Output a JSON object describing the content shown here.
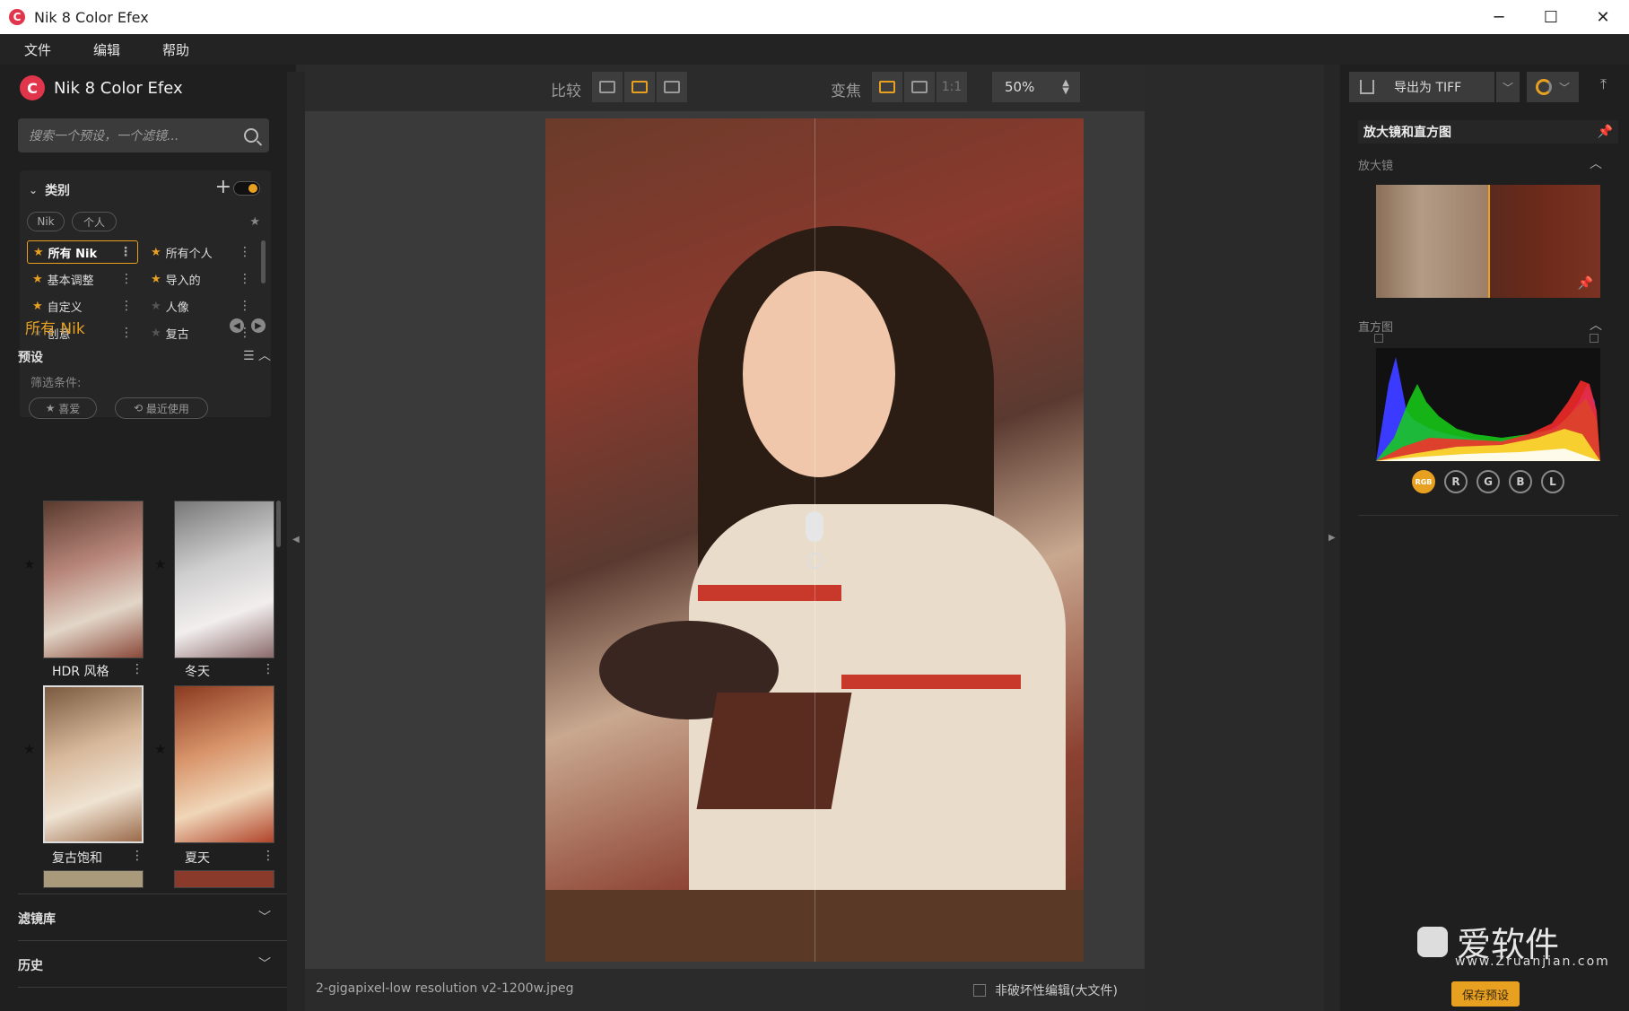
{
  "window": {
    "title": "Nik 8 Color Efex",
    "minimize": "─",
    "maximize": "☐",
    "close": "✕"
  },
  "menu": [
    "文件",
    "编辑",
    "帮助"
  ],
  "brand": {
    "name": "Nik 8 Color Efex"
  },
  "search": {
    "placeholder": "搜索一个预设，一个滤镜..."
  },
  "categories": {
    "title": "类别",
    "add": "+",
    "chips": [
      "Nik",
      "个人"
    ],
    "items": [
      {
        "label": "所有 Nik",
        "fav": true,
        "selected": true
      },
      {
        "label": "所有个人",
        "fav": true
      },
      {
        "label": "基本调整",
        "fav": true
      },
      {
        "label": "导入的",
        "fav": true
      },
      {
        "label": "自定义",
        "fav": true
      },
      {
        "label": "人像",
        "fav": false
      },
      {
        "label": "创意",
        "fav": false
      },
      {
        "label": "复古",
        "fav": false
      }
    ]
  },
  "current_collection": "所有 Nik",
  "presets": {
    "title": "预设",
    "filter_label": "筛选条件:",
    "filter_chips": [
      "喜爱",
      "最近使用"
    ],
    "thumbs": [
      {
        "label": "HDR 风格"
      },
      {
        "label": "冬天"
      },
      {
        "label": "复古饱和"
      },
      {
        "label": "夏天"
      }
    ]
  },
  "sections": {
    "filters": "滤镜库",
    "history": "历史"
  },
  "toolbar": {
    "compare_label": "比较",
    "zoom_label": "变焦",
    "one_to_one": "1:1",
    "zoom_value": "50%"
  },
  "status": {
    "filename": "2-gigapixel-low resolution v2-1200w.jpeg",
    "nondestructive": "非破坏性编辑(大文件)"
  },
  "right": {
    "export_label": "导出为 TIFF",
    "panel_title": "放大镜和直方图",
    "loupe_label": "放大镜",
    "histogram_label": "直方图",
    "channels": [
      "RGB",
      "R",
      "G",
      "B",
      "L"
    ],
    "watermark": "爱软件",
    "watermark_url": "www.Zruanjian.com",
    "save_preset": "保存预设"
  },
  "colors": {
    "accent": "#e8a020",
    "brand": "#e0354a"
  }
}
